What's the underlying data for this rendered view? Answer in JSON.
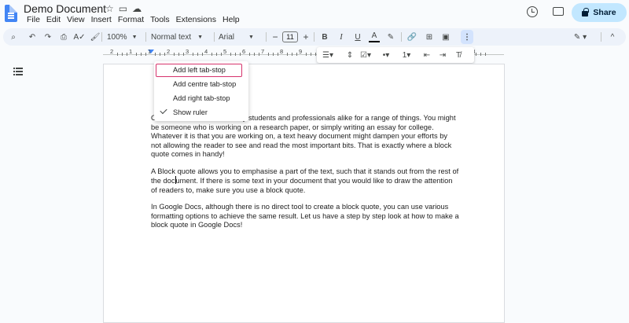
{
  "app": {
    "doc_title": "Demo Document",
    "menus": [
      "File",
      "Edit",
      "View",
      "Insert",
      "Format",
      "Tools",
      "Extensions",
      "Help"
    ],
    "share_label": "Share",
    "accent_color": "#c2e7ff"
  },
  "toolbar": {
    "zoom": "100%",
    "style": "Normal text",
    "font": "Arial",
    "font_size": "11",
    "decrease": "−",
    "increase": "+",
    "bold": "B",
    "italic": "I",
    "underline": "U",
    "text_color": "A",
    "more": "⋮",
    "collapse": "^"
  },
  "ruler": {
    "numbers": [
      "2",
      "1",
      "1",
      "2",
      "3",
      "4",
      "5",
      "6",
      "7",
      "8",
      "9",
      "10",
      "11",
      "12",
      "13",
      "14",
      "15",
      "16",
      "17",
      "18"
    ]
  },
  "context_menu": {
    "items": [
      "Add left tab-stop",
      "Add centre tab-stop",
      "Add right tab-stop",
      "Show ruler"
    ],
    "highlight_color": "#d6336c"
  },
  "document": {
    "para1_prefix": "C",
    "para1_visible": "y students and professionals alike for a range of things. You might be someone who is working on a research paper, or simply writing an essay for college. Whatever it is that you are working on, a text heavy document might dampen your efforts by not allowing the reader to see and read the most important bits. That is exactly where a block quote comes in handy!",
    "para2_a": "A Block quote allows you to emphasise a part of the text, such that it stands out from the rest of the doc",
    "para2_b": "ument. If there is some text in your document that you would like to draw the attention of readers to, make sure you use a block quote.",
    "para3": "In Google Docs, although there is no direct tool to create a block quote, you can use various formatting options to achieve the same result. Let us have a step by step look at how to make a block quote in Google Docs!"
  }
}
